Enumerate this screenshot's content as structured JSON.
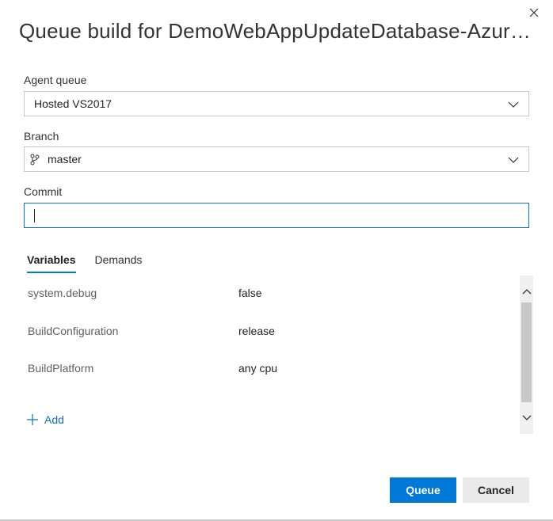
{
  "dialog": {
    "title": "Queue build for DemoWebAppUpdateDatabase-Azure Web...",
    "close_icon": "close-icon"
  },
  "agent_queue": {
    "label": "Agent queue",
    "selected": "Hosted VS2017"
  },
  "branch": {
    "label": "Branch",
    "selected": "master",
    "icon": "branch-icon"
  },
  "commit": {
    "label": "Commit",
    "value": ""
  },
  "tabs": [
    {
      "label": "Variables",
      "active": true
    },
    {
      "label": "Demands",
      "active": false
    }
  ],
  "variables": [
    {
      "name": "system.debug",
      "value": "false"
    },
    {
      "name": "BuildConfiguration",
      "value": "release"
    },
    {
      "name": "BuildPlatform",
      "value": "any cpu"
    }
  ],
  "add_label": "Add",
  "buttons": {
    "queue": "Queue",
    "cancel": "Cancel"
  },
  "colors": {
    "accent": "#0078d7",
    "link": "#106ebe"
  }
}
